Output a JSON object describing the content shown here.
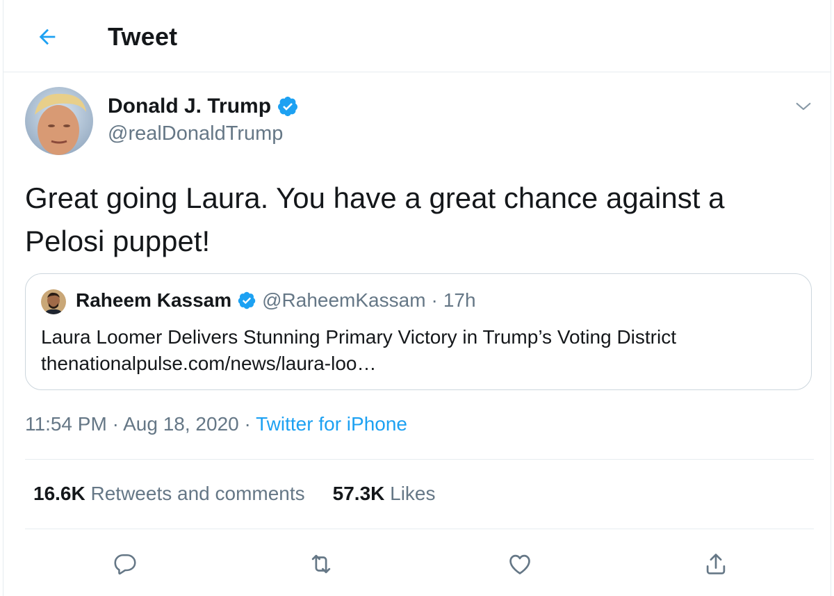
{
  "header": {
    "title": "Tweet",
    "back_icon": "arrow-left-icon"
  },
  "author": {
    "name": "Donald J. Trump",
    "handle": "@realDonaldTrump",
    "verified": true
  },
  "tweet": {
    "text": "Great going Laura. You have a great chance against a Pelosi puppet!"
  },
  "quote": {
    "name": "Raheem Kassam",
    "handle": "@RaheemKassam",
    "separator": "·",
    "time": "17h",
    "title": "Laura Loomer Delivers Stunning Primary Victory in Trump’s Voting District",
    "link": "thenationalpulse.com/news/laura-loo…"
  },
  "meta": {
    "time": "11:54 PM",
    "sep1": "·",
    "date": "Aug 18, 2020",
    "sep2": "·",
    "source": "Twitter for iPhone"
  },
  "stats": {
    "retweets_count": "16.6K",
    "retweets_label": "Retweets and comments",
    "likes_count": "57.3K",
    "likes_label": "Likes"
  },
  "actions": [
    "reply-icon",
    "retweet-icon",
    "like-icon",
    "share-icon"
  ],
  "colors": {
    "accent": "#1da1f2",
    "secondary_text": "#657786",
    "border": "#e6ecf0"
  }
}
